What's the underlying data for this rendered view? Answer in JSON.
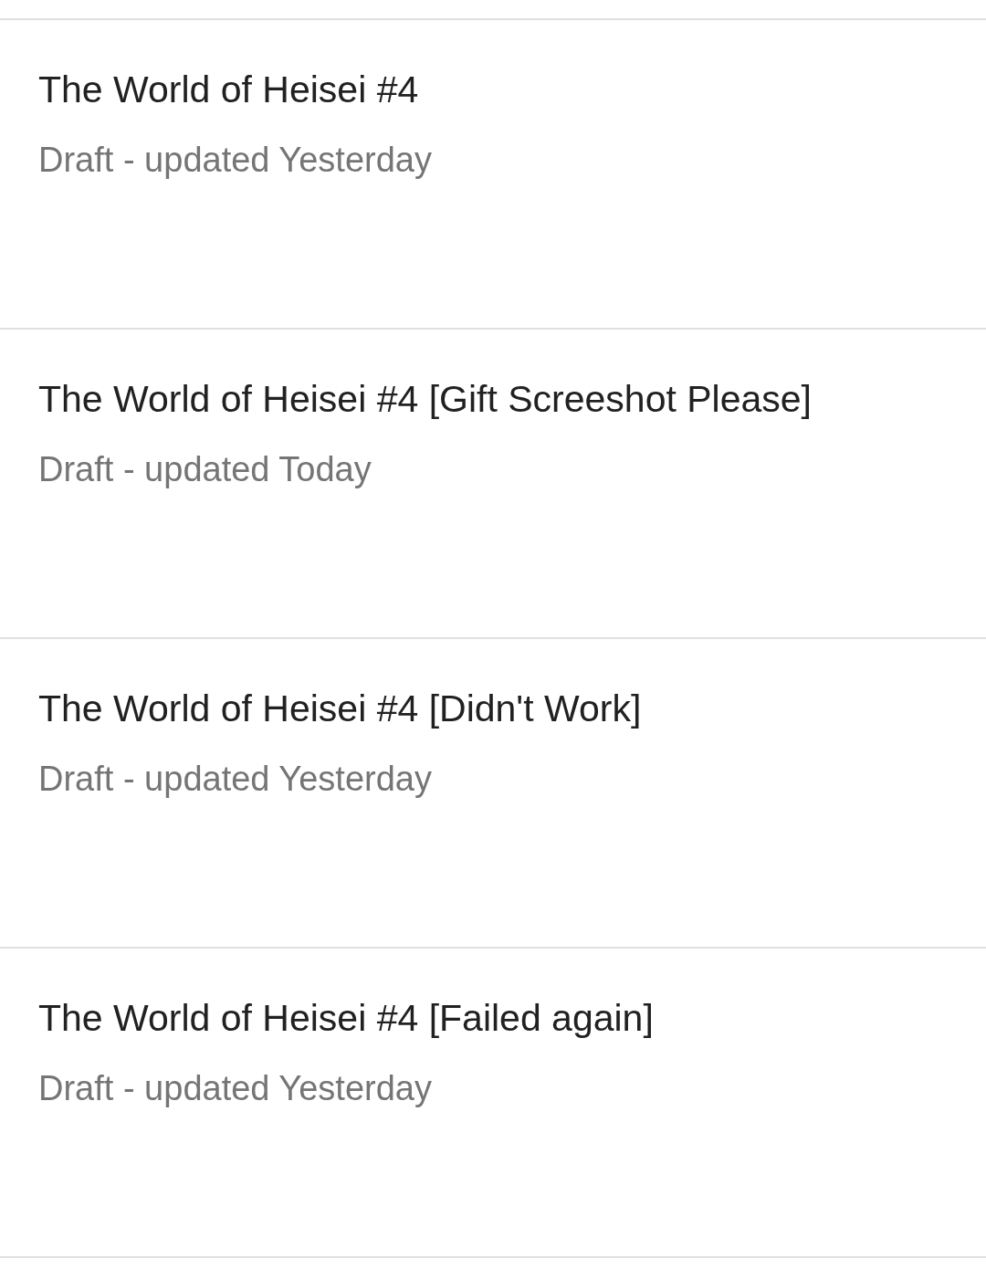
{
  "drafts": [
    {
      "title": "The World of Heisei #4",
      "status": "Draft - updated Yesterday"
    },
    {
      "title": "The World of Heisei #4 [Gift Screeshot Please]",
      "status": "Draft - updated Today"
    },
    {
      "title": "The World of Heisei #4 [Didn't Work]",
      "status": "Draft - updated Yesterday"
    },
    {
      "title": "The World of Heisei #4 [Failed again]",
      "status": "Draft - updated Yesterday"
    }
  ]
}
